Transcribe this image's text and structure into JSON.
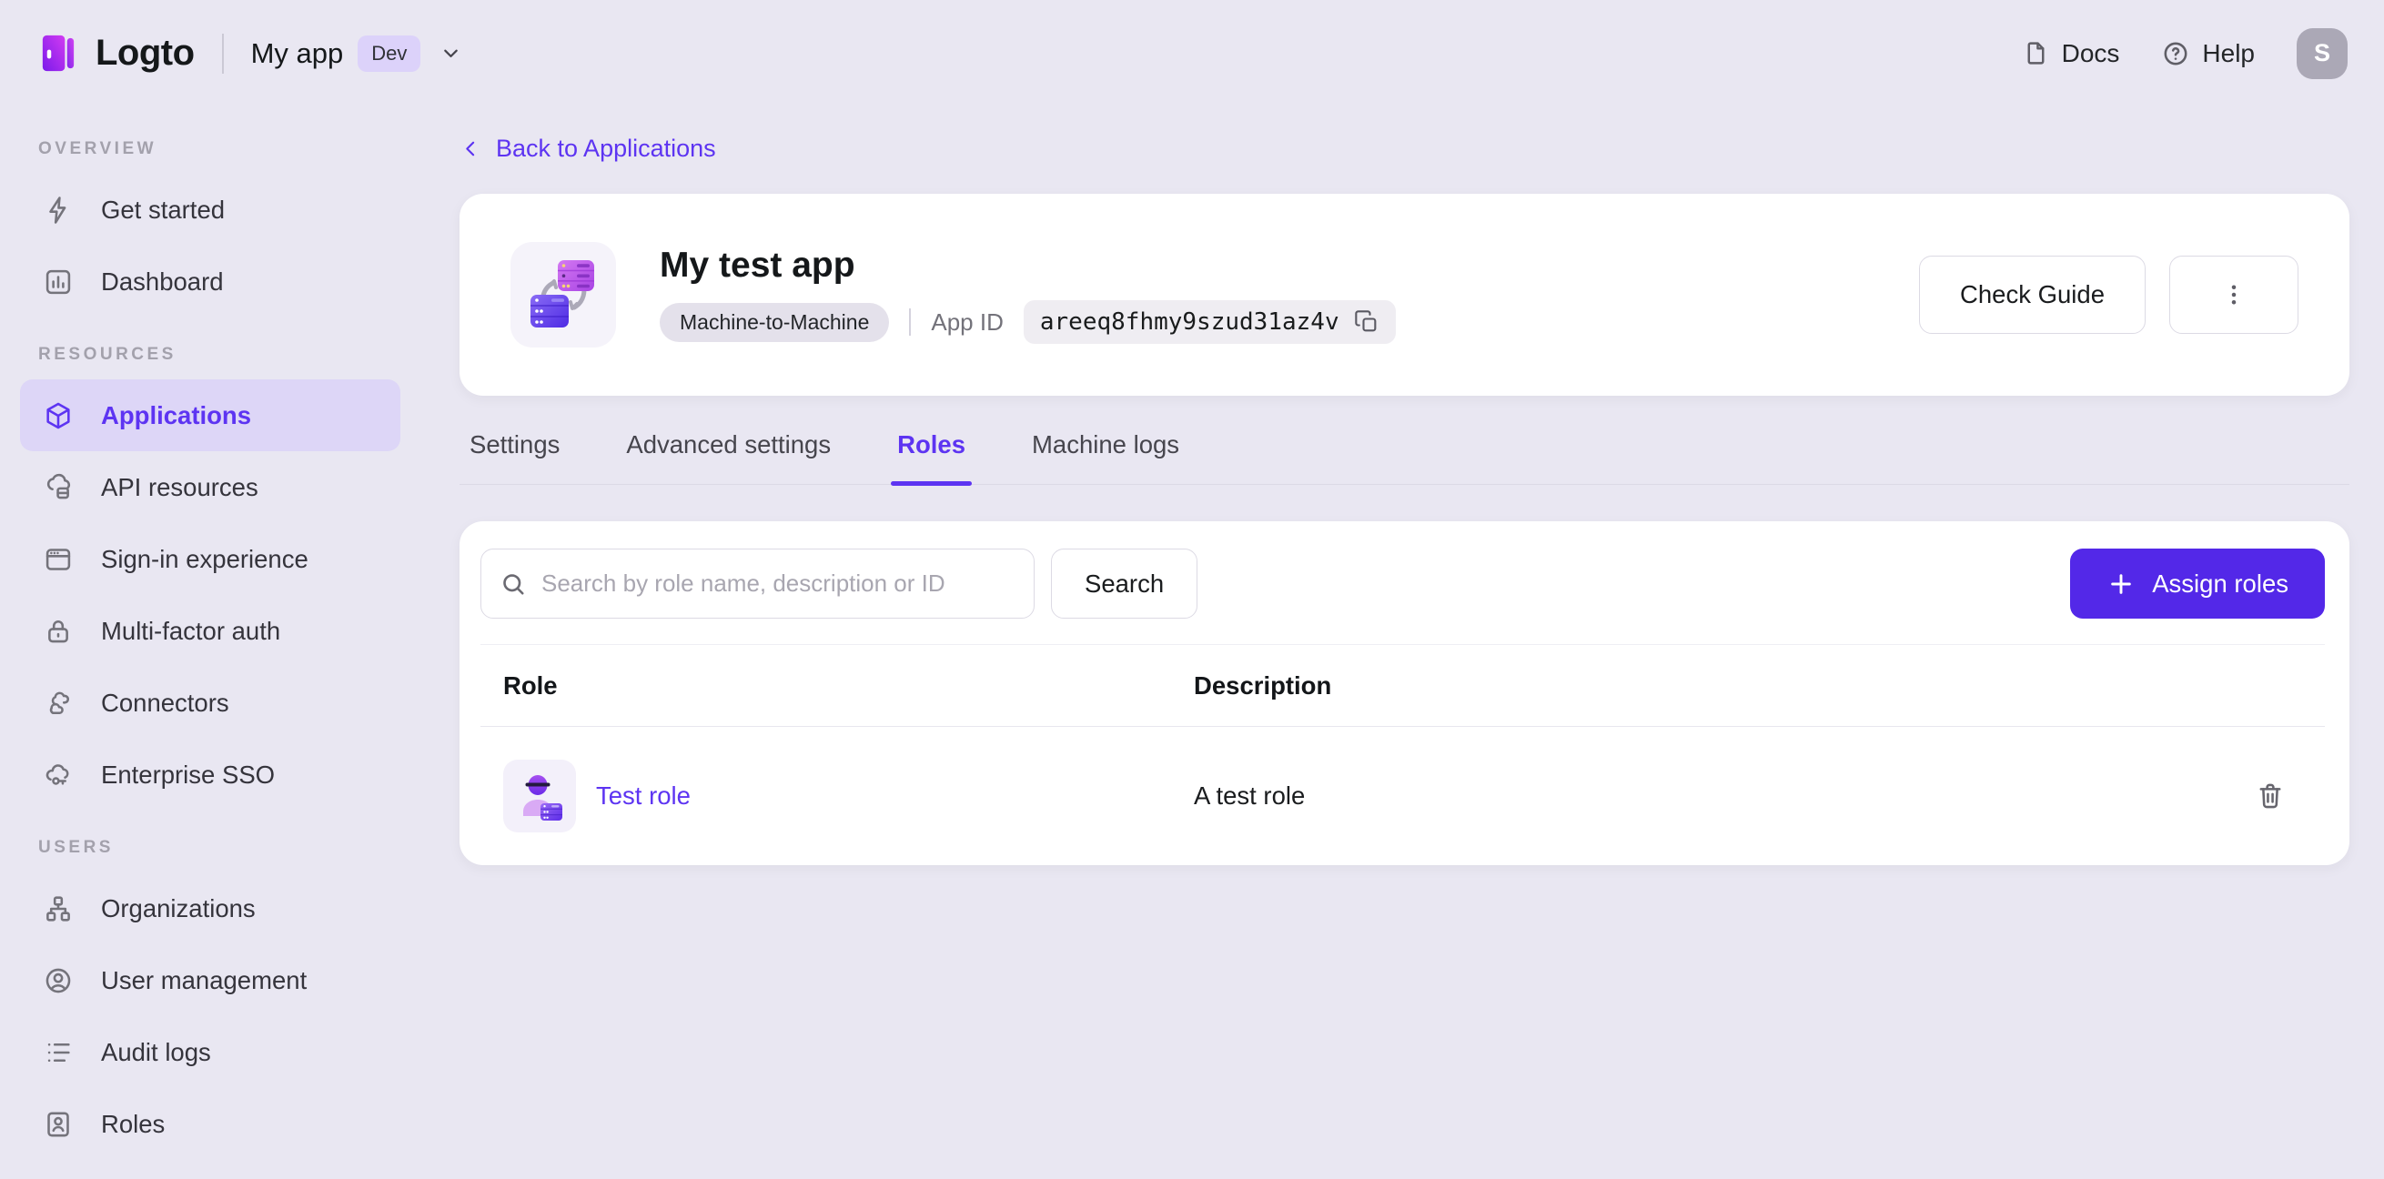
{
  "topbar": {
    "brand": "Logto",
    "app_name": "My app",
    "env_badge": "Dev",
    "docs_label": "Docs",
    "help_label": "Help",
    "avatar_initial": "S"
  },
  "sidebar": {
    "sections": [
      {
        "label": "OVERVIEW",
        "items": [
          {
            "label": "Get started"
          },
          {
            "label": "Dashboard"
          }
        ]
      },
      {
        "label": "RESOURCES",
        "items": [
          {
            "label": "Applications",
            "active": true
          },
          {
            "label": "API resources"
          },
          {
            "label": "Sign-in experience"
          },
          {
            "label": "Multi-factor auth"
          },
          {
            "label": "Connectors"
          },
          {
            "label": "Enterprise SSO"
          }
        ]
      },
      {
        "label": "USERS",
        "items": [
          {
            "label": "Organizations"
          },
          {
            "label": "User management"
          },
          {
            "label": "Audit logs"
          },
          {
            "label": "Roles"
          }
        ]
      }
    ]
  },
  "main": {
    "back_link": "Back to Applications",
    "app_card": {
      "title": "My test app",
      "type_badge": "Machine-to-Machine",
      "app_id_label": "App ID",
      "app_id": "areeq8fhmy9szud31az4v",
      "check_guide_label": "Check Guide"
    },
    "tabs": [
      {
        "label": "Settings",
        "active": false
      },
      {
        "label": "Advanced settings",
        "active": false
      },
      {
        "label": "Roles",
        "active": true
      },
      {
        "label": "Machine logs",
        "active": false
      }
    ],
    "roles_panel": {
      "search_placeholder": "Search by role name, description or ID",
      "search_button": "Search",
      "assign_button": "Assign roles",
      "table": {
        "columns": [
          "Role",
          "Description"
        ],
        "rows": [
          {
            "role": "Test role",
            "description": "A test role"
          }
        ]
      }
    }
  },
  "colors": {
    "accent": "#5D34F2",
    "accent_strong": "#5328E8",
    "page_bg": "#E9E7F2",
    "pill_bg": "#DDD6F7",
    "dev_badge_bg": "#DCD2FA",
    "type_badge_bg": "#E4E1EB",
    "code_bg": "#EFEDF2",
    "border": "#DCDAE4",
    "text": "#17191C",
    "text_secondary": "#73727A",
    "muted": "#A8A6B0",
    "avatar_bg": "#ABA8B6"
  }
}
